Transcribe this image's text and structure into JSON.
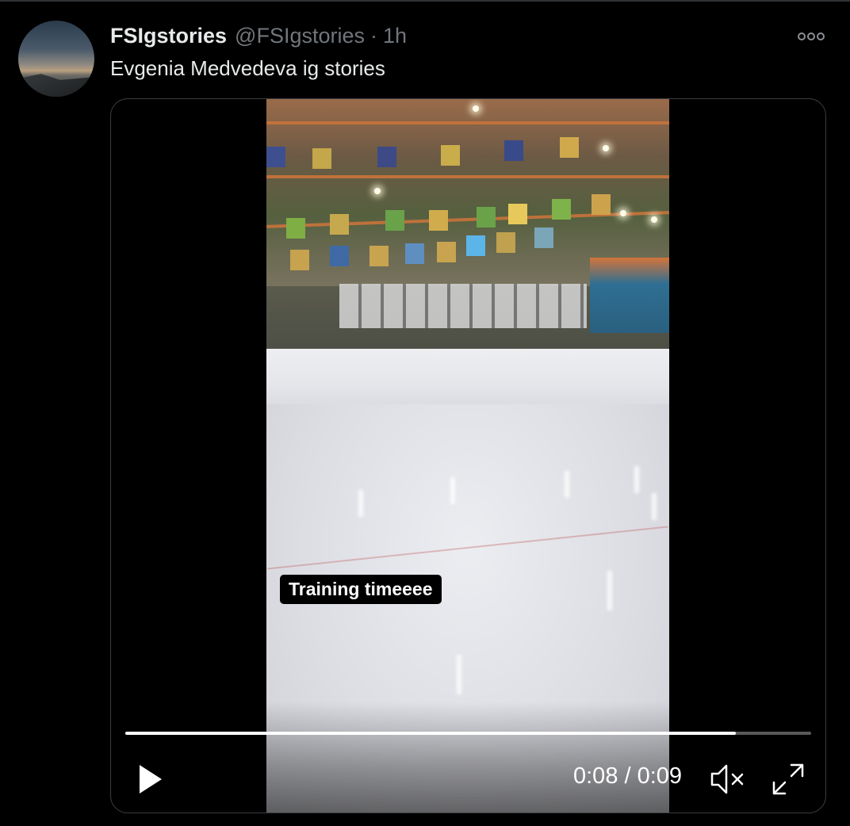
{
  "tweet": {
    "display_name": "FSIgstories",
    "handle": "@FSIgstories",
    "separator": "·",
    "time": "1h",
    "text": "Evgenia Medvedeva ig stories"
  },
  "video": {
    "caption": "Training timeeee",
    "timecode": "0:08 / 0:09",
    "progress_fraction": 0.89,
    "muted": true
  },
  "icons": {
    "more": "more-horizontal-icon",
    "play": "play-icon",
    "mute": "volume-muted-icon",
    "fullscreen": "fullscreen-icon"
  },
  "colors": {
    "background": "#000000",
    "primary_text": "#e7e9ea",
    "secondary_text": "#71767b",
    "media_border": "#3a3d41"
  }
}
